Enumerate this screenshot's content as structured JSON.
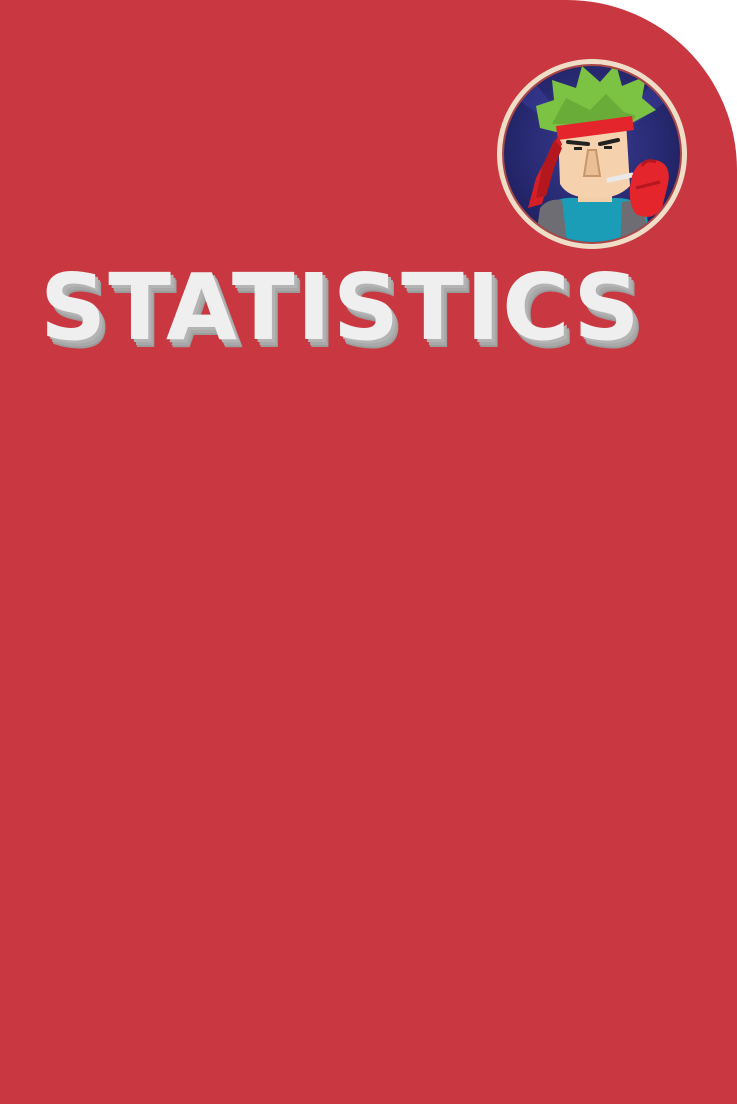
{
  "screen": {
    "title": "STATISTICS",
    "background_color": "#c93740",
    "title_color": "#efefef",
    "title_shadow_color": "#a9a9a9"
  },
  "avatar": {
    "icon": "character-avatar-icon",
    "ring_color": "#f0ddc8",
    "backdrop_color": "#2e2f7e",
    "hair_color": "#7cc243",
    "bandana_color": "#e5252c",
    "shirt_color": "#1b9db7"
  }
}
